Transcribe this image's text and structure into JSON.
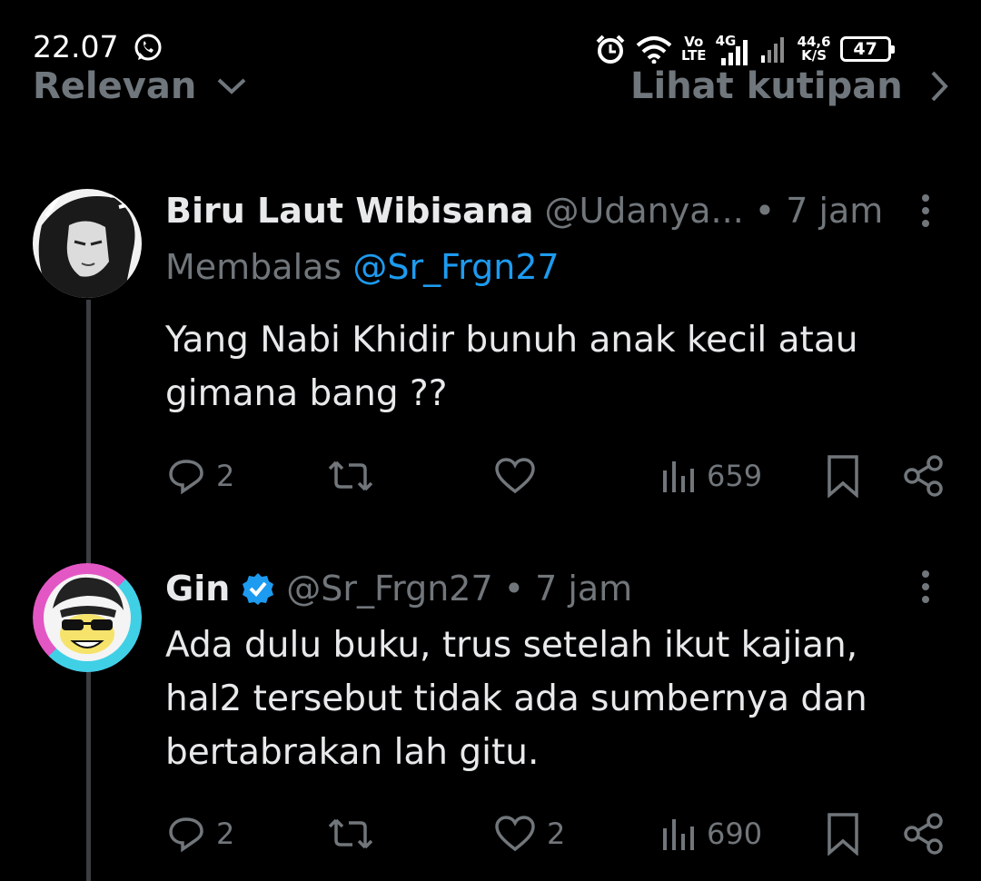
{
  "status_bar": {
    "time": "22.07",
    "network_top": "Vo",
    "network_bottom": "LTE",
    "network_type": "4G",
    "speed_value": "44,6",
    "speed_unit": "K/S",
    "battery": "47",
    "icons": [
      "whatsapp-icon",
      "alarm-icon",
      "wifi-icon",
      "signal-icon",
      "signal-weak-icon"
    ]
  },
  "header": {
    "sort_label": "Relevan",
    "quotes_label": "Lihat kutipan"
  },
  "tweets": [
    {
      "display_name": "Biru Laut Wibisana",
      "handle": "@Udanya...",
      "separator": "•",
      "time": "7 jam",
      "reply_prefix": "Membalas",
      "reply_to": "@Sr_Frgn27",
      "text_line1": "Yang Nabi Khidir bunuh anak kecil atau",
      "text_line2": "gimana bang ??",
      "replies": "2",
      "reposts": "",
      "likes": "",
      "views": "659",
      "verified": false
    },
    {
      "display_name": "Gin",
      "handle": "@Sr_Frgn27",
      "separator": "•",
      "time": "7 jam",
      "text_line1": "Ada dulu buku, trus setelah ikut kajian,",
      "text_line2": "hal2 tersebut tidak ada sumbernya dan",
      "text_line3": "bertabrakan lah gitu.",
      "replies": "2",
      "reposts": "",
      "likes": "2",
      "views": "690",
      "verified": true,
      "verified_color": "#1d9bf0"
    }
  ],
  "colors": {
    "background": "#000000",
    "text": "#e7e9ea",
    "muted": "#71767b",
    "link": "#1d9bf0",
    "avatar2_ring_pink": "#e357c4",
    "avatar2_ring_cyan": "#3fd0e6"
  }
}
